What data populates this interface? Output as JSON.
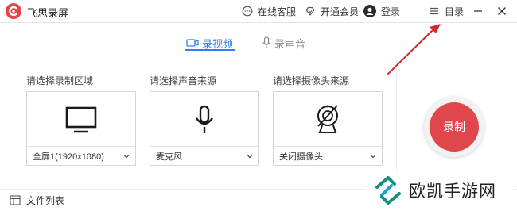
{
  "app": {
    "title": "飞思录屏",
    "accent": "#e0474c"
  },
  "titlebar": {
    "online_service": "在线客服",
    "vip": "开通会员",
    "login": "登录",
    "menu": "目录",
    "icons": [
      "chat-bubble-icon",
      "diamond-icon",
      "user-avatar-icon",
      "menu-lines-icon",
      "minimize-icon",
      "close-icon"
    ]
  },
  "tabs": [
    {
      "label": "录视频",
      "active": true,
      "icon": "video-camera-icon"
    },
    {
      "label": "录声音",
      "active": false,
      "icon": "microphone-icon"
    }
  ],
  "sources": [
    {
      "label": "请选择录制区域",
      "value": "全屏1(1920x1080)",
      "icon": "monitor-icon"
    },
    {
      "label": "请选择声音来源",
      "value": "麦克风",
      "icon": "microphone-icon"
    },
    {
      "label": "请选择摄像头来源",
      "value": "关闭摄像头",
      "icon": "webcam-off-icon"
    }
  ],
  "record": {
    "label": "录制",
    "color": "#e0474c"
  },
  "bottom": {
    "file_list": "文件列表"
  },
  "watermark": {
    "text": "欧凯手游网"
  }
}
